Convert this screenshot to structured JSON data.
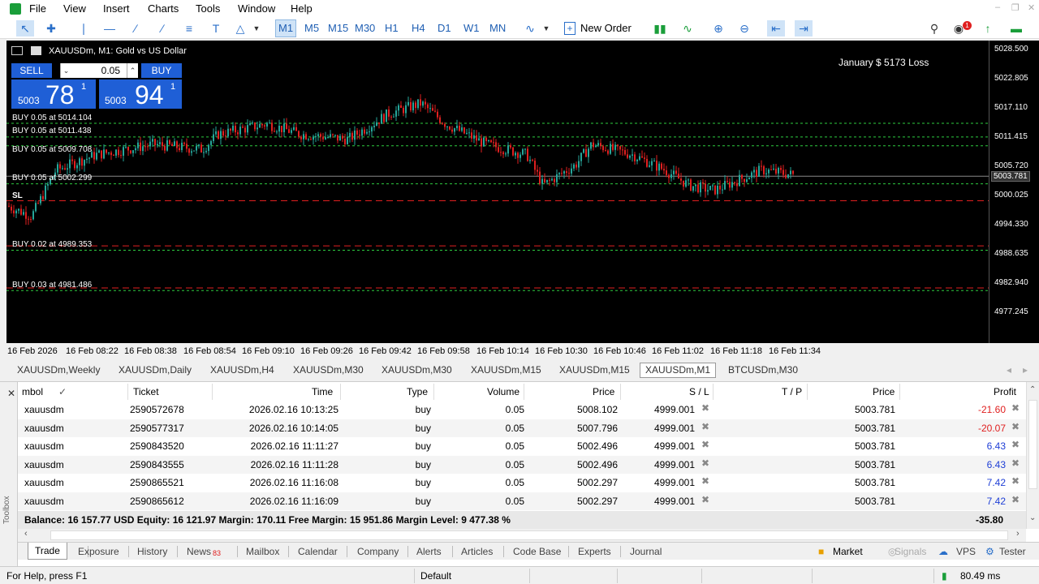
{
  "menu": [
    "File",
    "View",
    "Insert",
    "Charts",
    "Tools",
    "Window",
    "Help"
  ],
  "toolbar": {
    "timeframes": [
      "M1",
      "M5",
      "M15",
      "M30",
      "H1",
      "H4",
      "D1",
      "W1",
      "MN"
    ],
    "active_timeframe": "M1",
    "new_order": "New Order",
    "notification_count": "1"
  },
  "chart": {
    "title": "XAUUSDm, M1:  Gold vs US Dollar",
    "top_note": "January   $ 5173 Loss",
    "sell_label": "SELL",
    "buy_label": "BUY",
    "volume": "0.05",
    "sell_price_small": "5003",
    "sell_price_big": "78",
    "sell_price_sup": "1",
    "buy_price_small": "5003",
    "buy_price_big": "94",
    "buy_price_sup": "1",
    "price_axis": [
      "5028.500",
      "5022.805",
      "5017.110",
      "5011.415",
      "5005.720",
      "5003.781",
      "5000.025",
      "4994.330",
      "4988.635",
      "4982.940",
      "4977.245"
    ],
    "time_axis": [
      "16 Feb 2026",
      "16 Feb 08:22",
      "16 Feb 08:38",
      "16 Feb 08:54",
      "16 Feb 09:10",
      "16 Feb 09:26",
      "16 Feb 09:42",
      "16 Feb 09:58",
      "16 Feb 10:14",
      "16 Feb 10:30",
      "16 Feb 10:46",
      "16 Feb 11:02",
      "16 Feb 11:18",
      "16 Feb 11:34"
    ],
    "trade_labels": [
      "BUY 0.05 at 5014.104",
      "BUY 0.05 at 5011.438",
      "BUY 0.05 at 5009.708",
      "BUY 0.05 at 5002.299",
      "SL",
      "BUY 0.02 at 4989.353",
      "BUY 0.03 at 4981.486"
    ]
  },
  "chart_tabs": [
    "XAUUSDm,Weekly",
    "XAUUSDm,Daily",
    "XAUUSDm,H4",
    "XAUUSDm,M30",
    "XAUUSDm,M30",
    "XAUUSDm,M15",
    "XAUUSDm,M15",
    "XAUUSDm,M1",
    "BTCUSDm,M30"
  ],
  "active_chart_tab": "XAUUSDm,M1",
  "table": {
    "headers": [
      "mbol",
      "Ticket",
      "Time",
      "Type",
      "Volume",
      "Price",
      "S / L",
      "T / P",
      "Price",
      "Profit"
    ],
    "rows": [
      {
        "symbol": "xauusdm",
        "ticket": "2590572678",
        "time": "2026.02.16 10:13:25",
        "type": "buy",
        "volume": "0.05",
        "price": "5008.102",
        "sl": "4999.001",
        "tp": "",
        "cur_price": "5003.781",
        "profit": "-21.60",
        "neg": true
      },
      {
        "symbol": "xauusdm",
        "ticket": "2590577317",
        "time": "2026.02.16 10:14:05",
        "type": "buy",
        "volume": "0.05",
        "price": "5007.796",
        "sl": "4999.001",
        "tp": "",
        "cur_price": "5003.781",
        "profit": "-20.07",
        "neg": true
      },
      {
        "symbol": "xauusdm",
        "ticket": "2590843520",
        "time": "2026.02.16 11:11:27",
        "type": "buy",
        "volume": "0.05",
        "price": "5002.496",
        "sl": "4999.001",
        "tp": "",
        "cur_price": "5003.781",
        "profit": "6.43",
        "neg": false
      },
      {
        "symbol": "xauusdm",
        "ticket": "2590843555",
        "time": "2026.02.16 11:11:28",
        "type": "buy",
        "volume": "0.05",
        "price": "5002.496",
        "sl": "4999.001",
        "tp": "",
        "cur_price": "5003.781",
        "profit": "6.43",
        "neg": false
      },
      {
        "symbol": "xauusdm",
        "ticket": "2590865521",
        "time": "2026.02.16 11:16:08",
        "type": "buy",
        "volume": "0.05",
        "price": "5002.297",
        "sl": "4999.001",
        "tp": "",
        "cur_price": "5003.781",
        "profit": "7.42",
        "neg": false
      },
      {
        "symbol": "xauusdm",
        "ticket": "2590865612",
        "time": "2026.02.16 11:16:09",
        "type": "buy",
        "volume": "0.05",
        "price": "5002.297",
        "sl": "4999.001",
        "tp": "",
        "cur_price": "5003.781",
        "profit": "7.42",
        "neg": false
      }
    ],
    "balance_line": "Balance: 16 157.77 USD  Equity: 16 121.97  Margin: 170.11  Free Margin: 15 951.86  Margin Level: 9 477.38 %",
    "total_profit": "-35.80"
  },
  "toolbox_label": "Toolbox",
  "bottom_tabs": [
    "Trade",
    "Exposure",
    "History",
    "News",
    "Mailbox",
    "Calendar",
    "Company",
    "Alerts",
    "Articles",
    "Code Base",
    "Experts",
    "Journal"
  ],
  "news_count": "83",
  "right_tabs": [
    "Market",
    "Signals",
    "VPS",
    "Tester"
  ],
  "status": {
    "help": "For Help, press F1",
    "profile": "Default",
    "speed": "80.49 ms"
  },
  "colors": {
    "bull": "#26a69a",
    "bear": "#e02020",
    "buy_line": "#2ecc40",
    "sl_line": "#e02020",
    "otc_blue": "#1f5fd6",
    "profit_pos": "#1f3fd6",
    "profit_neg": "#e02020"
  }
}
